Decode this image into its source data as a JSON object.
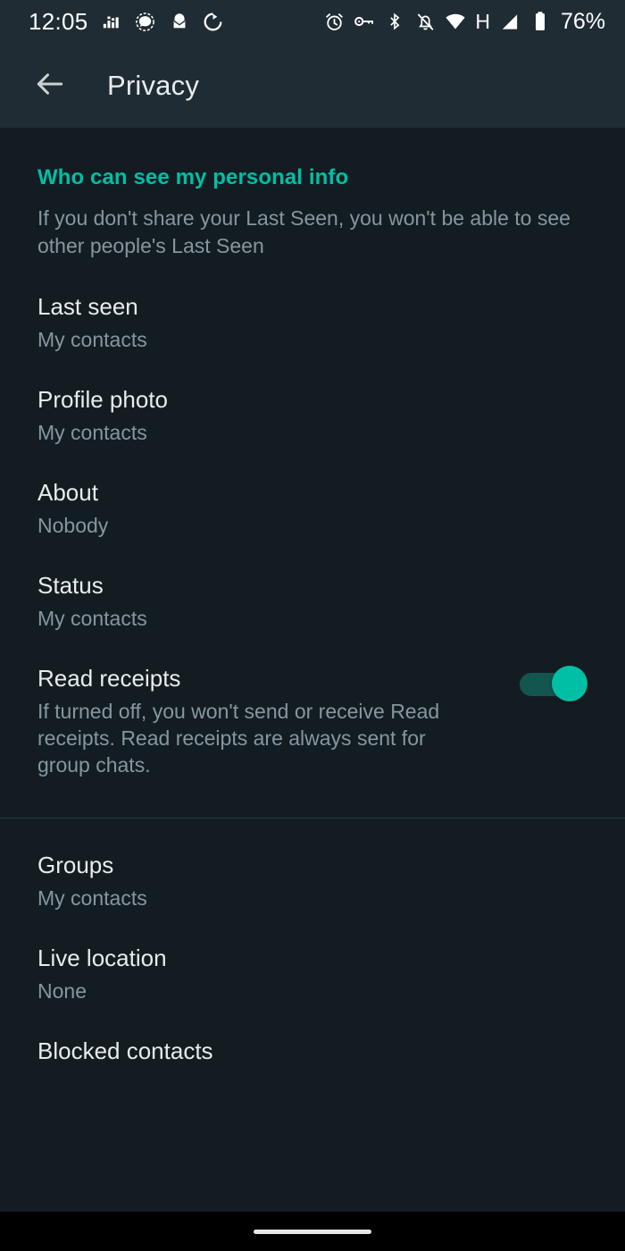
{
  "status_bar": {
    "time": "12:05",
    "battery_percent": "76%",
    "network_type": "H",
    "left_icons": [
      "equalizer-icon",
      "signal-messenger-icon",
      "mail-icon",
      "sync-icon"
    ],
    "right_icons": [
      "alarm-icon",
      "vpn-key-icon",
      "bluetooth-icon",
      "notifications-off-icon",
      "wifi-icon",
      "cellular-signal-icon",
      "battery-icon"
    ]
  },
  "toolbar": {
    "back_icon": "arrow-left-icon",
    "title": "Privacy"
  },
  "colors": {
    "accent": "#00bfa5",
    "toolbar_bg": "#1f2c34",
    "page_bg": "#131c21",
    "primary_text": "#e8eced",
    "secondary_text": "#8696a0",
    "toggle_track": "#12564f",
    "divider": "#2a3942"
  },
  "sections": [
    {
      "header": "Who can see my personal info",
      "description": "If you don't share your Last Seen, you won't be able to see other people's Last Seen",
      "rows": [
        {
          "title": "Last seen",
          "subtitle": "My contacts"
        },
        {
          "title": "Profile photo",
          "subtitle": "My contacts"
        },
        {
          "title": "About",
          "subtitle": "Nobody"
        },
        {
          "title": "Status",
          "subtitle": "My contacts"
        },
        {
          "title": "Read receipts",
          "description": "If turned off, you won't send or receive Read receipts. Read receipts are always sent for group chats.",
          "toggle": true,
          "toggle_on": true
        }
      ]
    },
    {
      "rows": [
        {
          "title": "Groups",
          "subtitle": "My contacts"
        },
        {
          "title": "Live location",
          "subtitle": "None"
        },
        {
          "title": "Blocked contacts"
        }
      ]
    }
  ],
  "nav_bar": {
    "handle": "gesture-pill"
  }
}
